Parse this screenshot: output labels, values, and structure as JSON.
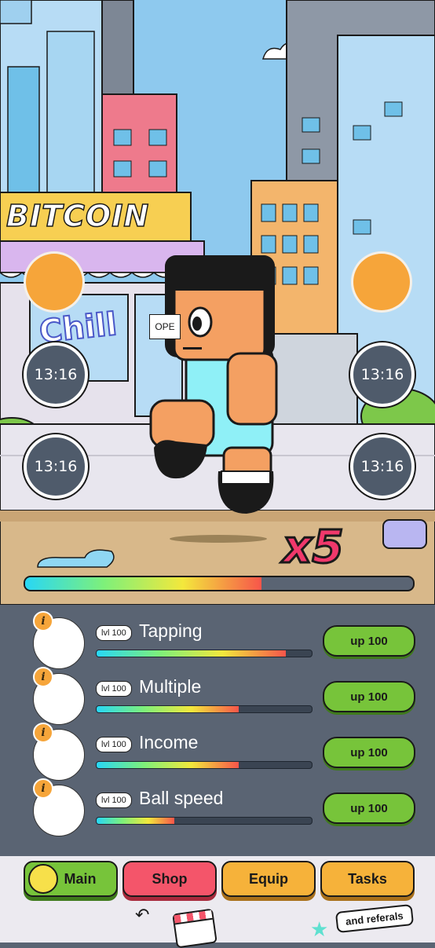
{
  "scene": {
    "shop_sign": "BITCOIN",
    "graffiti": "Chill",
    "door_sign": "OPE",
    "multiplier": "x5",
    "progress_fraction": 0.61,
    "timers": [
      "13:16",
      "13:16",
      "13:16",
      "13:16"
    ]
  },
  "upgrades": [
    {
      "name": "Tapping",
      "level": "lvl 100",
      "button": "up 100",
      "progress": 0.88,
      "info": "i"
    },
    {
      "name": "Multiple",
      "level": "lvl 100",
      "button": "up 100",
      "progress": 0.66,
      "info": "i"
    },
    {
      "name": "Income",
      "level": "lvl 100",
      "button": "up 100",
      "progress": 0.66,
      "info": "i"
    },
    {
      "name": "Ball speed",
      "level": "lvl 100",
      "button": "up 100",
      "progress": 0.36,
      "info": "i"
    }
  ],
  "nav": {
    "main": "Main",
    "shop": "Shop",
    "equip": "Equip",
    "tasks": "Tasks",
    "referrals_note": "and referals"
  },
  "colors": {
    "panel": "#5a6473",
    "upgrade_button": "#77c43a",
    "main_tab": "#77c43a",
    "shop_tab": "#f4556a",
    "equip_tab": "#f6b23a",
    "tasks_tab": "#f6b23a",
    "orb": "#f6a53a"
  }
}
